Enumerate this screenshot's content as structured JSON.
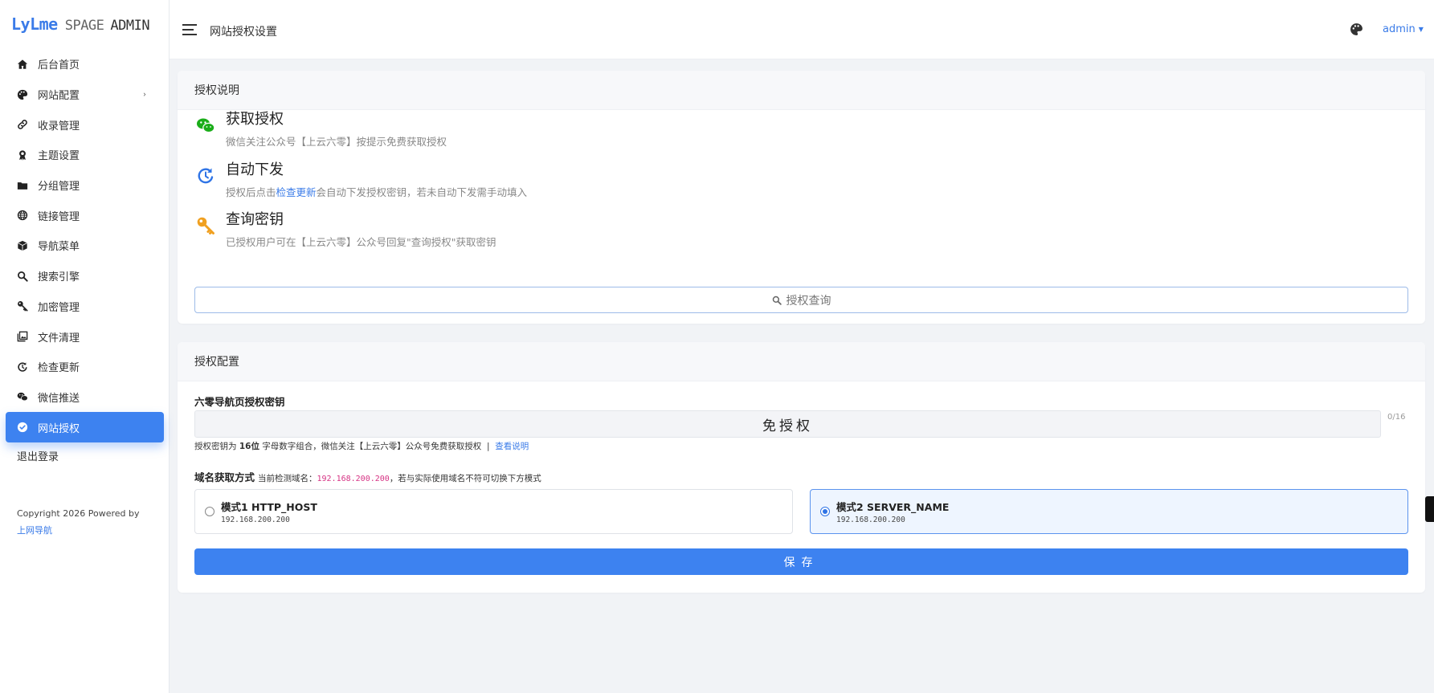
{
  "logo": {
    "part1": "LyLme",
    "part2": "SPAGE",
    "part3": "ADMIN"
  },
  "sidebar": {
    "items": [
      {
        "label": "后台首页",
        "icon": "home-icon"
      },
      {
        "label": "网站配置",
        "icon": "palette-icon",
        "has_submenu": true,
        "arrow": "›"
      },
      {
        "label": "收录管理",
        "icon": "link-icon"
      },
      {
        "label": "主题设置",
        "icon": "award-icon"
      },
      {
        "label": "分组管理",
        "icon": "folder-icon"
      },
      {
        "label": "链接管理",
        "icon": "globe-icon"
      },
      {
        "label": "导航菜单",
        "icon": "box-icon"
      },
      {
        "label": "搜索引擎",
        "icon": "search-icon"
      },
      {
        "label": "加密管理",
        "icon": "key-icon"
      },
      {
        "label": "文件清理",
        "icon": "images-icon"
      },
      {
        "label": "检查更新",
        "icon": "refresh-icon"
      },
      {
        "label": "微信推送",
        "icon": "wechat-icon"
      },
      {
        "label": "网站授权",
        "icon": "check-circle-icon",
        "active": true
      }
    ],
    "logout": "退出登录",
    "copyright": "Copyright 2026 Powered by",
    "copyright_link": "上网导航"
  },
  "header": {
    "title": "网站授权设置",
    "user": "admin",
    "caret": "▼"
  },
  "card1": {
    "title": "授权说明",
    "features": [
      {
        "icon": "wechat-icon",
        "title": "获取授权",
        "desc": "微信关注公众号【上云六零】按提示免费获取授权"
      },
      {
        "icon": "refresh-icon",
        "title": "自动下发",
        "desc_pre": "授权后点击",
        "desc_link": "检查更新",
        "desc_post": "会自动下发授权密钥，若未自动下发需手动填入"
      },
      {
        "icon": "key-icon",
        "title": "查询密钥",
        "desc": "已授权用户可在【上云六零】公众号回复\"查询授权\"获取密钥"
      }
    ],
    "query_button": "授权查询"
  },
  "card2": {
    "title": "授权配置",
    "key_label": "六零导航页授权密钥",
    "key_value": "免授权",
    "key_counter": "0/16",
    "hint_pre": "授权密钥为",
    "hint_bold": "16位",
    "hint_mid": "字母数字组合，微信关注【上云六零】公众号免费获取授权  |  ",
    "hint_link": "查看说明",
    "domain_label": "域名获取方式",
    "domain_detect_pre": "当前检测域名：",
    "domain_detected": "192.168.200.200",
    "domain_detect_post": "，若与实际使用域名不符可切换下方模式",
    "modes": [
      {
        "title": "模式1 HTTP_HOST",
        "ip": "192.168.200.200",
        "selected": false
      },
      {
        "title": "模式2 SERVER_NAME",
        "ip": "192.168.200.200",
        "selected": true
      }
    ],
    "save_button": "保存"
  },
  "colors": {
    "accent": "#3d82f0",
    "link": "#3a7be8",
    "wechat": "#1aad19",
    "key": "#f0a020"
  }
}
